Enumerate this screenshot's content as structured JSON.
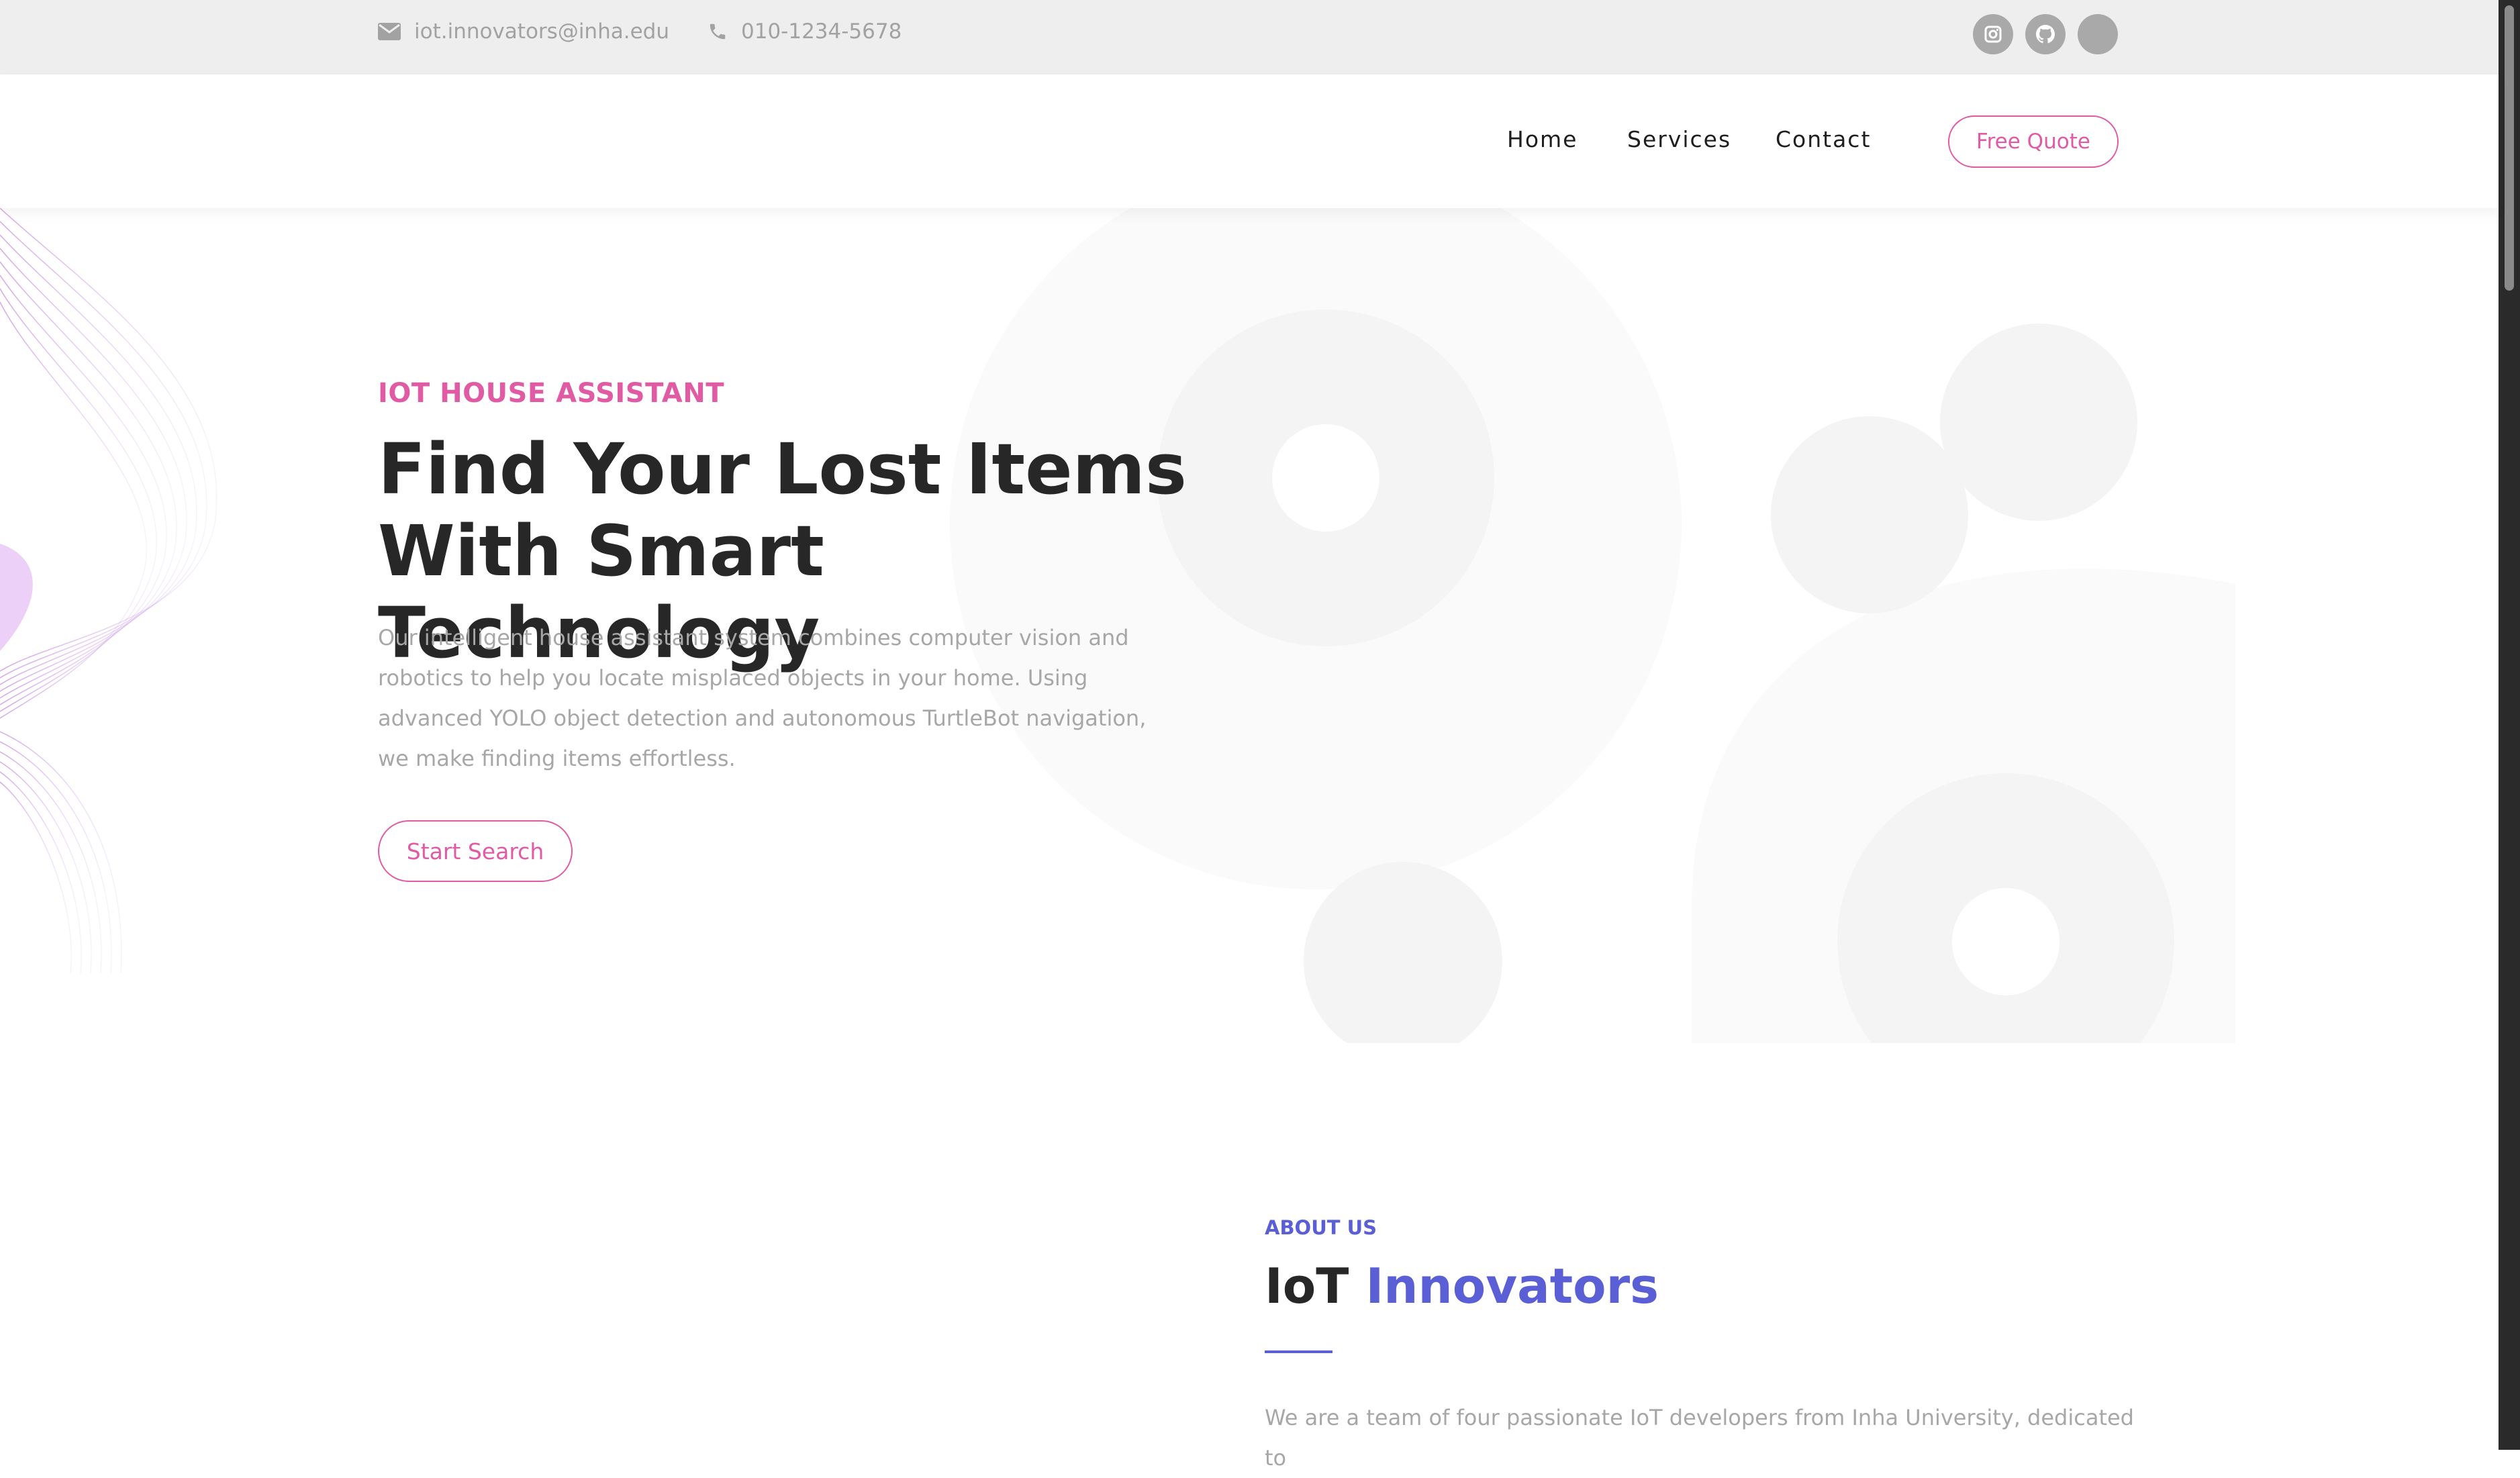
{
  "topbar": {
    "email": "iot.innovators@inha.edu",
    "phone": "010-1234-5678",
    "social": [
      {
        "name": "instagram-icon"
      },
      {
        "name": "github-icon"
      },
      {
        "name": "blank-social-icon"
      }
    ]
  },
  "nav": {
    "links": [
      "Home",
      "Services",
      "Contact"
    ],
    "cta": "Free Quote"
  },
  "hero": {
    "eyebrow": "IOT HOUSE ASSISTANT",
    "title_line1": "Find Your Lost Items",
    "title_line2": "With Smart Technology",
    "description": "Our intelligent house assistant system combines computer vision and robotics to help you locate misplaced objects in your home. Using advanced YOLO object detection and autonomous TurtleBot navigation, we make finding items effortless.",
    "button": "Start Search"
  },
  "about": {
    "eyebrow": "ABOUT US",
    "title_prefix": "IoT",
    "title_accent": "Innovators",
    "text": "We are a team of four passionate IoT developers from Inha University, dedicated to"
  },
  "colors": {
    "accent_pink": "#e05ba4",
    "accent_indigo": "#5b5fd6",
    "heading": "#272727",
    "body_text": "#a7a7a7",
    "topbar_bg": "#eeeeee"
  }
}
